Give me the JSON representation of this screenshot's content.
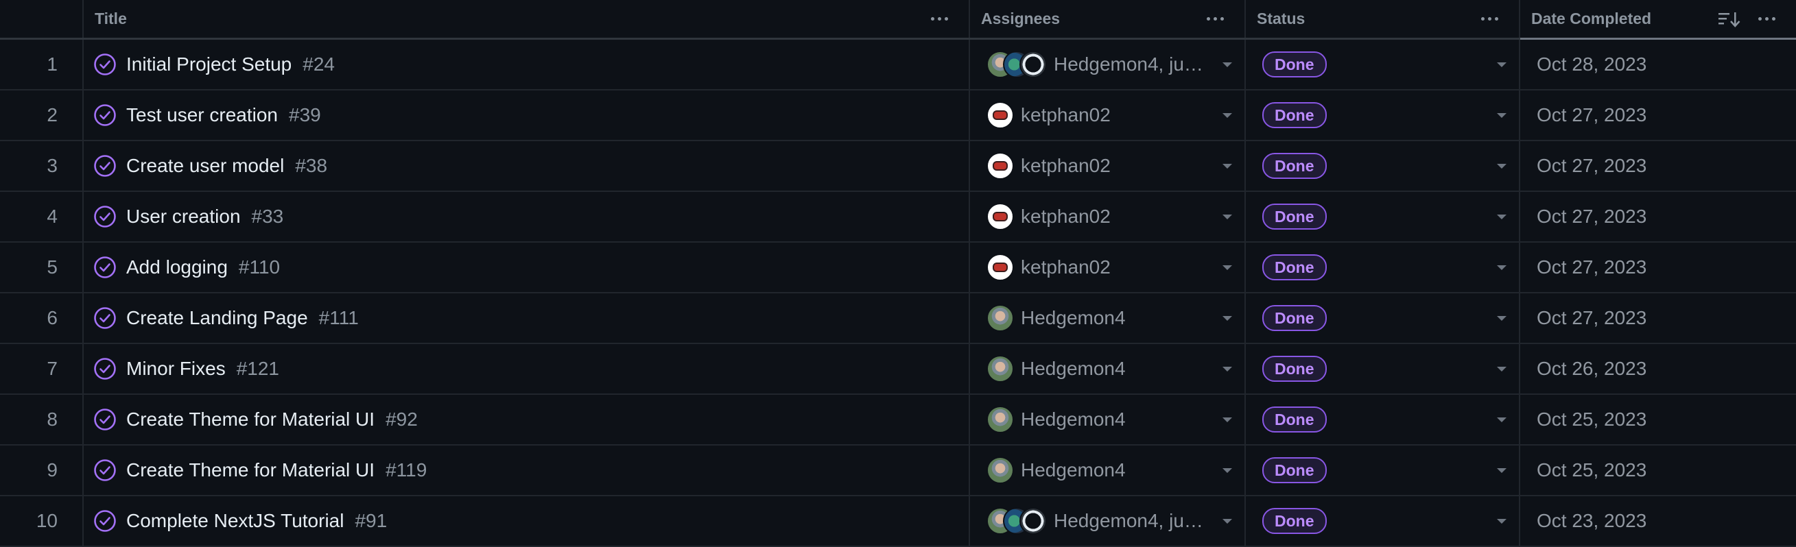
{
  "columns": {
    "title": "Title",
    "assignees": "Assignees",
    "status": "Status",
    "date_completed": "Date Completed"
  },
  "colors": {
    "background": "#0d1117",
    "done_badge": "#bc8cff",
    "closed_icon": "#a371f7"
  },
  "icons": {
    "column_menu": "kebab-horizontal-icon",
    "sort": "sort-descending-icon",
    "issue_state": "issue-closed-check-icon",
    "dropdown": "triangle-down-icon"
  },
  "rows": [
    {
      "index": "1",
      "title": "Initial Project Setup",
      "number": "#24",
      "assignees": "Hedgemon4, justi...",
      "avatars": [
        "hedge",
        "justi",
        "ghost"
      ],
      "status": "Done",
      "date": "Oct 28, 2023"
    },
    {
      "index": "2",
      "title": "Test user creation",
      "number": "#39",
      "assignees": "ketphan02",
      "avatars": [
        "ket"
      ],
      "status": "Done",
      "date": "Oct 27, 2023"
    },
    {
      "index": "3",
      "title": "Create user model",
      "number": "#38",
      "assignees": "ketphan02",
      "avatars": [
        "ket"
      ],
      "status": "Done",
      "date": "Oct 27, 2023"
    },
    {
      "index": "4",
      "title": "User creation",
      "number": "#33",
      "assignees": "ketphan02",
      "avatars": [
        "ket"
      ],
      "status": "Done",
      "date": "Oct 27, 2023"
    },
    {
      "index": "5",
      "title": "Add logging",
      "number": "#110",
      "assignees": "ketphan02",
      "avatars": [
        "ket"
      ],
      "status": "Done",
      "date": "Oct 27, 2023"
    },
    {
      "index": "6",
      "title": "Create Landing Page",
      "number": "#111",
      "assignees": "Hedgemon4",
      "avatars": [
        "hedge"
      ],
      "status": "Done",
      "date": "Oct 27, 2023"
    },
    {
      "index": "7",
      "title": "Minor Fixes",
      "number": "#121",
      "assignees": "Hedgemon4",
      "avatars": [
        "hedge"
      ],
      "status": "Done",
      "date": "Oct 26, 2023"
    },
    {
      "index": "8",
      "title": "Create Theme for Material UI",
      "number": "#92",
      "assignees": "Hedgemon4",
      "avatars": [
        "hedge"
      ],
      "status": "Done",
      "date": "Oct 25, 2023"
    },
    {
      "index": "9",
      "title": "Create Theme for Material UI",
      "number": "#119",
      "assignees": "Hedgemon4",
      "avatars": [
        "hedge"
      ],
      "status": "Done",
      "date": "Oct 25, 2023"
    },
    {
      "index": "10",
      "title": "Complete NextJS Tutorial",
      "number": "#91",
      "assignees": "Hedgemon4, justi...",
      "avatars": [
        "hedge",
        "justi",
        "ghost"
      ],
      "status": "Done",
      "date": "Oct 23, 2023"
    }
  ]
}
